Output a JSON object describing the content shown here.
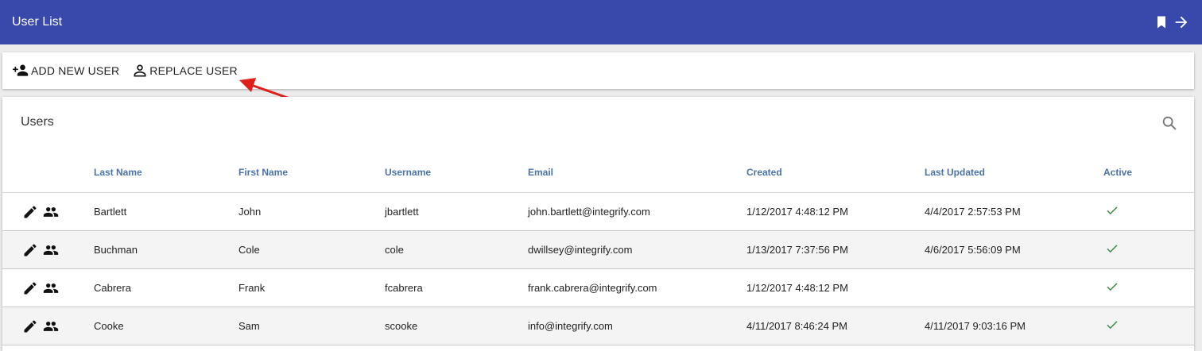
{
  "app": {
    "title": "User List"
  },
  "toolbar": {
    "add_label": "ADD NEW USER",
    "replace_label": "REPLACE USER"
  },
  "card": {
    "title": "Users"
  },
  "table": {
    "columns": [
      "Last Name",
      "First Name",
      "Username",
      "Email",
      "Created",
      "Last Updated",
      "Active"
    ],
    "rows": [
      {
        "last": "Bartlett",
        "first": "John",
        "username": "jbartlett",
        "email": "john.bartlett@integrify.com",
        "created": "1/12/2017 4:48:12 PM",
        "updated": "4/4/2017 2:57:53 PM",
        "active": true
      },
      {
        "last": "Buchman",
        "first": "Cole",
        "username": "cole",
        "email": "dwillsey@integrify.com",
        "created": "1/13/2017 7:37:56 PM",
        "updated": "4/6/2017 5:56:09 PM",
        "active": true
      },
      {
        "last": "Cabrera",
        "first": "Frank",
        "username": "fcabrera",
        "email": "frank.cabrera@integrify.com",
        "created": "1/12/2017 4:48:12 PM",
        "updated": "",
        "active": true
      },
      {
        "last": "Cooke",
        "first": "Sam",
        "username": "scooke",
        "email": "info@integrify.com",
        "created": "4/11/2017 8:46:24 PM",
        "updated": "4/11/2017 9:03:16 PM",
        "active": true
      }
    ]
  },
  "icons": {
    "appbar": [
      "bookmark-icon",
      "arrow-right-icon"
    ],
    "toolbar": [
      "person-add-icon",
      "person-outline-icon"
    ],
    "row": [
      "pencil-icon",
      "people-icon",
      "check-icon"
    ],
    "search": "search-icon"
  },
  "colors": {
    "appbar": "#3949ab",
    "header_text": "#4a73a8",
    "check": "#388e3c",
    "annotation_arrow": "#e0201b"
  }
}
